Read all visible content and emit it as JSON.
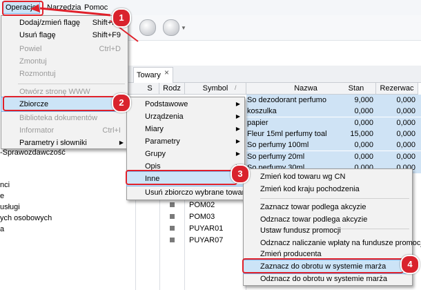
{
  "menubar": {
    "items": [
      "Operacje",
      "Narzędzia",
      "Pomoc"
    ]
  },
  "left_panel": {
    "lines": [
      "-Sprawozdawczość",
      "nci",
      "e",
      "usługi",
      "ych osobowych",
      "a"
    ]
  },
  "tab": {
    "label": "Towary",
    "close": "×"
  },
  "grid": {
    "headers": [
      "S",
      "Rodz",
      "Symbol",
      "Nazwa",
      "Stan",
      "Rezerwac"
    ],
    "sort_indicator": "/",
    "rows": [
      {
        "nazwa": "So dezodorant perfumo",
        "stan": "9,000",
        "rez": "0,000"
      },
      {
        "nazwa": "koszulka",
        "stan": "0,000",
        "rez": "0,000"
      },
      {
        "nazwa": "papier",
        "stan": "0,000",
        "rez": "0,000"
      },
      {
        "nazwa": "Fleur 15ml perfumy toal",
        "stan": "15,000",
        "rez": "0,000"
      },
      {
        "nazwa": "So perfumy 100ml",
        "stan": "0,000",
        "rez": "0,000"
      },
      {
        "nazwa": "So perfumy 20ml",
        "stan": "0,000",
        "rez": "0,000"
      },
      {
        "nazwa": "So perfumy 30ml",
        "stan": "0,000",
        "rez": "0,000"
      }
    ],
    "symbols": [
      "POM02",
      "POM03",
      "PUYAR01",
      "PUYAR07"
    ]
  },
  "operacje_menu": {
    "items": [
      {
        "label": "Dodaj/zmień flagę",
        "shortcut": "Shift+F9",
        "disabled": false
      },
      {
        "label": "Usuń flagę",
        "shortcut": "Shift+F9",
        "disabled": false
      },
      {
        "label": "Powiel",
        "shortcut": "Ctrl+D",
        "disabled": true
      },
      {
        "label": "Zmontuj",
        "shortcut": "",
        "disabled": true
      },
      {
        "label": "Rozmontuj",
        "shortcut": "",
        "disabled": true
      },
      {
        "label": "Otwórz stronę WWW",
        "shortcut": "",
        "disabled": true
      },
      {
        "label": "Zbiorcze",
        "shortcut": "",
        "disabled": false
      },
      {
        "label": "Biblioteka dokumentów",
        "shortcut": "",
        "disabled": true
      },
      {
        "label": "Informator",
        "shortcut": "Ctrl+I",
        "disabled": true
      },
      {
        "label": "Parametry i słowniki",
        "shortcut": "",
        "disabled": false
      }
    ]
  },
  "zbiorcze_menu": {
    "items": [
      "Podstawowe",
      "Urządzenia",
      "Miary",
      "Parametry",
      "Grupy",
      "Opis",
      "Inne",
      "Usuń zbiorczo wybrane towary"
    ]
  },
  "inne_menu": {
    "items": [
      "Zmień kod towaru wg CN",
      "Zmień kod kraju pochodzenia",
      "Zaznacz towar podlega akcyzie",
      "Odznacz towar podlega akcyzie",
      "Ustaw fundusz promocji",
      "Odznacz naliczanie wpłaty na fundusze promocji",
      "Zmień producenta",
      "Zaznacz do obrotu w systemie marża",
      "Odznacz do obrotu w systemie marża"
    ]
  },
  "badges": [
    "1",
    "2",
    "3",
    "4"
  ],
  "colors": {
    "highlight": "#cce4f7",
    "selection": "#cfe3f5",
    "annotation": "#d9232d"
  }
}
